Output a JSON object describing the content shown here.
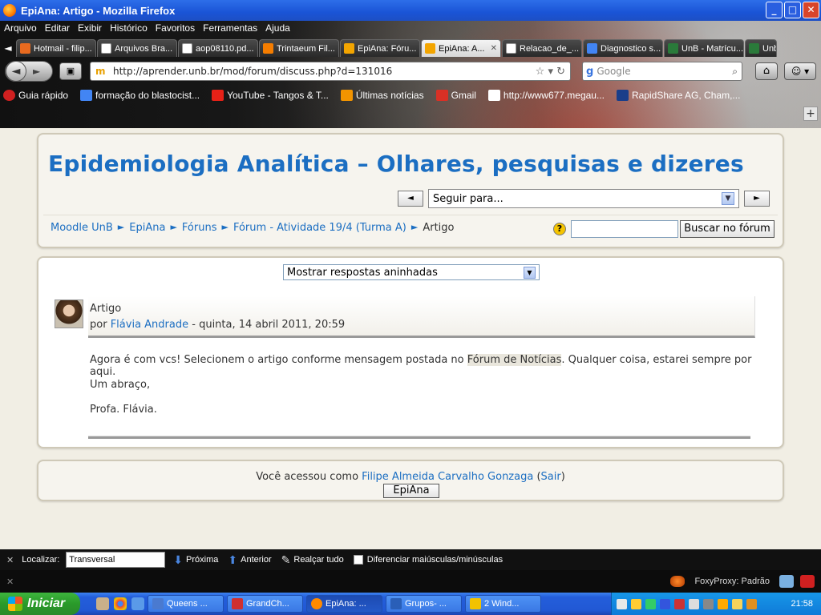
{
  "window": {
    "title": "EpiAna: Artigo - Mozilla Firefox",
    "buttons": [
      "_",
      "□",
      "✕"
    ]
  },
  "menu": [
    "Arquivo",
    "Editar",
    "Exibir",
    "Histórico",
    "Favoritos",
    "Ferramentas",
    "Ajuda"
  ],
  "tabs": [
    {
      "label": "Hotmail - filip...",
      "icon_color": "#e86a1f",
      "active": false
    },
    {
      "label": "Arquivos Bra...",
      "icon_color": "#ffffff",
      "active": false
    },
    {
      "label": "aop08110.pd...",
      "icon_color": "#ffffff",
      "active": false
    },
    {
      "label": "Trintaeum Fil...",
      "icon_color": "#f57d00",
      "active": false
    },
    {
      "label": "EpiAna: Fóru...",
      "icon_color": "#f3a500",
      "active": false
    },
    {
      "label": "EpiAna: A...",
      "icon_color": "#f3a500",
      "active": true
    },
    {
      "label": "Relacao_de_...",
      "icon_color": "#ffffff",
      "active": false
    },
    {
      "label": "Diagnostico s...",
      "icon_color": "#4285f4",
      "active": false
    },
    {
      "label": "UnB - Matrícu...",
      "icon_color": "#2a7a3a",
      "active": false
    },
    {
      "label": "Unb",
      "icon_color": "#2a7a3a",
      "active": false
    }
  ],
  "navbar": {
    "url": "http://aprender.unb.br/mod/forum/discuss.php?d=131016",
    "search_placeholder": "Google"
  },
  "bookmarks": [
    {
      "label": "Guia rápido",
      "icon_color": "#d02020"
    },
    {
      "label": "formação do blastocist...",
      "icon_color": "#4285f4"
    },
    {
      "label": "YouTube - Tangos & T...",
      "icon_color": "#e62117"
    },
    {
      "label": "Últimas notícias",
      "icon_color": "#f29400"
    },
    {
      "label": "Gmail",
      "icon_color": "#d93025"
    },
    {
      "label": "http://www677.megau...",
      "icon_color": "#ffffff"
    },
    {
      "label": "RapidShare AG, Cham,...",
      "icon_color": "#1a3e8a"
    }
  ],
  "page": {
    "site_title": "Epidemiologia Analítica – Olhares, pesquisas e dizeres",
    "jump_to": "Seguir para...",
    "prev": "◄",
    "next": "►",
    "breadcrumbs": [
      "Moodle UnB",
      "EpiAna",
      "Fóruns",
      "Fórum - Atividade 19/4 (Turma A)"
    ],
    "breadcrumb_current": "Artigo",
    "search_button": "Buscar no fórum",
    "display_mode": "Mostrar respostas aninhadas",
    "post": {
      "subject": "Artigo",
      "by": "por",
      "author": "Flávia Andrade",
      "date": "- quinta, 14 abril 2011, 20:59",
      "para1_before": "Agora é com vcs! Selecionem o artigo conforme mensagem postada no",
      "para1_link": "Fórum de Notícias",
      "para1_after": ". Qualquer coisa, estarei sempre por aqui.",
      "para2": "Um abraço,",
      "para3": "Profa. Flávia."
    },
    "footer": {
      "logged_prefix": "Você acessou como",
      "user": "Filipe Almeida Carvalho Gonzaga",
      "logout": "Sair",
      "course_button": "EpiAna"
    }
  },
  "findbar": {
    "label": "Localizar:",
    "value": "Transversal",
    "next": "Próxima",
    "prev": "Anterior",
    "highlight": "Realçar tudo",
    "match_case": "Diferenciar maiúsculas/minúsculas"
  },
  "statusbar": {
    "proxy": "FoxyProxy: Padrão"
  },
  "taskbar": {
    "start": "Iniciar",
    "items": [
      {
        "label": "Queens ...",
        "icon_color": "#4a7ad0",
        "active": false
      },
      {
        "label": "GrandCh...",
        "icon_color": "#d03030",
        "active": false
      },
      {
        "label": "EpiAna: ...",
        "icon_color": "#ff8a00",
        "active": true
      },
      {
        "label": "Grupos- ...",
        "icon_color": "#2a5fb8",
        "active": false
      },
      {
        "label": "2 Wind...",
        "icon_color": "#f2c200",
        "active": false
      }
    ],
    "clock": "21:58"
  }
}
